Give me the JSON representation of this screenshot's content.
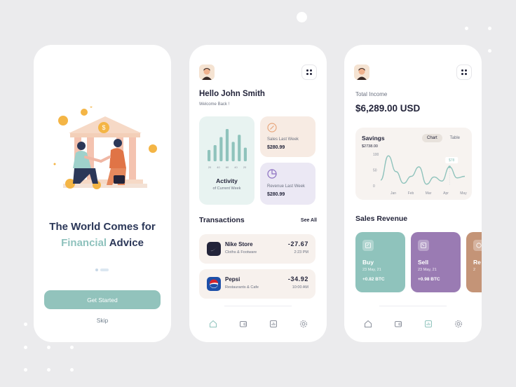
{
  "colors": {
    "background": "#ebebed",
    "accent_teal": "#92c3bc",
    "buy_card": "#8fc3bc",
    "sell_card": "#9a7bb3",
    "third_card": "#c49477",
    "heading_navy": "#2b3758"
  },
  "onboarding": {
    "headline_line1": "The World Comes for",
    "headline_accent": "Financial",
    "headline_rest": " Advice",
    "cta_label": "Get Started",
    "skip_label": "Skip",
    "pager_active_index": 1
  },
  "home": {
    "greeting": "Hello John Smith",
    "subgreeting": "Welcome Back !",
    "activity": {
      "title": "Activity",
      "subtitle": "of Current Week",
      "bar_heights_relative": [
        0.35,
        0.5,
        0.75,
        1.0,
        0.6,
        0.82,
        0.42
      ],
      "axis_labels": [
        "20",
        "40",
        "60",
        "40",
        "20"
      ]
    },
    "sales_last_week": {
      "label": "Sales Last Week",
      "value": "$280.99",
      "icon": "percent-circle-icon"
    },
    "revenue_last_week": {
      "label": "Revenue Last Week",
      "value": "$280.99",
      "icon": "pie-chart-icon"
    },
    "transactions_title": "Transactions",
    "see_all_label": "See All",
    "transactions": [
      {
        "name": "Nike Store",
        "category": "Cloths & Footware",
        "amount": "-27.67",
        "time": "2:23 PM",
        "logo": "nike-logo-icon"
      },
      {
        "name": "Pepsi",
        "category": "Restaurants & Cafe",
        "amount": "-34.92",
        "time": "10:00 AM",
        "logo": "pepsi-logo-icon"
      }
    ],
    "nav": [
      "home-icon",
      "wallet-icon",
      "chart-icon",
      "settings-icon"
    ]
  },
  "income": {
    "total_label": "Total Income",
    "total_value": "$6,289.00 USD",
    "savings": {
      "title": "Savings",
      "amount": "$2738.00",
      "toggle": [
        "Chart",
        "Table"
      ],
      "active_toggle": "Chart",
      "tooltip": "$78"
    },
    "sales_revenue_title": "Sales Revenue",
    "revenue_cards": [
      {
        "title": "Buy",
        "date": "23 May, 21",
        "value": "+0.82 BTC",
        "icon": "buy-icon"
      },
      {
        "title": "Sell",
        "date": "23 May, 21",
        "value": "+0.98 BTC",
        "icon": "sell-icon"
      },
      {
        "title": "Re",
        "date": "2",
        "value": "",
        "icon": "revenue-icon"
      }
    ],
    "nav": [
      "home-icon",
      "wallet-icon",
      "chart-icon",
      "settings-icon"
    ]
  },
  "chart_data": {
    "type": "line",
    "title": "Savings",
    "x": [
      "Jan",
      "Feb",
      "Mar",
      "Apr",
      "May"
    ],
    "series": [
      {
        "values": [
          18,
          95,
          45,
          8,
          30,
          60,
          5,
          28,
          15,
          60,
          25,
          30
        ]
      }
    ],
    "y_ticks": [
      0,
      50,
      100
    ],
    "ylim": [
      0,
      100
    ],
    "grid": false,
    "annotation": "$78"
  }
}
